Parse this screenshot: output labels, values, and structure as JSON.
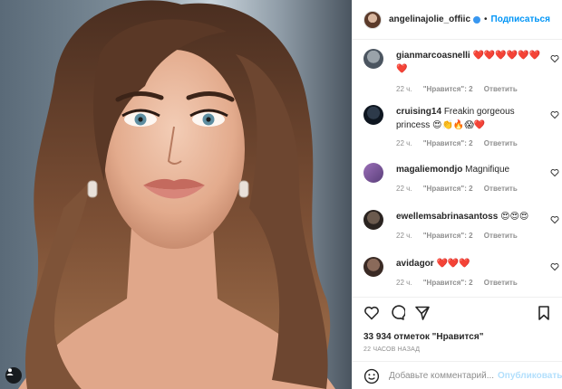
{
  "post": {
    "photo_alt": "portrait photo",
    "header": {
      "username": "angelinajolie_offiic",
      "separator": "•",
      "follow_label": "Подписаться"
    },
    "comments": [
      {
        "username": "gianmarcoasnelli",
        "text": "❤️❤️❤️❤️❤️❤️❤️",
        "time": "22 ч.",
        "likes": "\"Нравится\": 2",
        "reply": "Ответить"
      },
      {
        "username": "cruising14",
        "text": "Freakin gorgeous princess 😍👏🔥😱❤️",
        "time": "22 ч.",
        "likes": "\"Нравится\": 2",
        "reply": "Ответить"
      },
      {
        "username": "magaliemondjo",
        "text": "Magnifique",
        "time": "22 ч.",
        "likes": "\"Нравится\": 2",
        "reply": "Ответить"
      },
      {
        "username": "ewellemsabrinasantoss",
        "text": "😍😍😍",
        "time": "22 ч.",
        "likes": "\"Нравится\": 2",
        "reply": "Ответить"
      },
      {
        "username": "avidagor",
        "text": "❤️❤️❤️",
        "time": "22 ч.",
        "likes": "\"Нравится\": 2",
        "reply": "Ответить"
      }
    ],
    "likes_count": "33 934 отметок \"Нравится\"",
    "timestamp": "22 ЧАСОВ НАЗАД",
    "comment_box": {
      "placeholder": "Добавьте комментарий...",
      "publish_label": "Опубликовать"
    },
    "icons": {
      "like": "heart-outline-icon",
      "comment": "speech-bubble-icon",
      "share": "paper-plane-icon",
      "save": "bookmark-icon",
      "emoji": "smiley-icon",
      "corner": "user-tag-icon"
    },
    "colors": {
      "accent": "#0095f6",
      "text": "#262626",
      "muted": "#8e8e8e",
      "border": "#efefef"
    }
  }
}
